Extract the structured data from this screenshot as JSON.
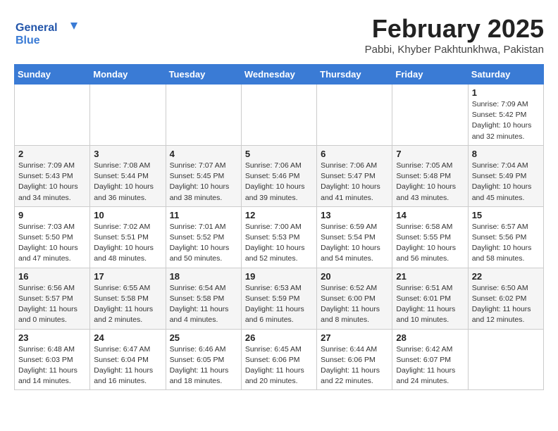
{
  "header": {
    "title": "February 2025",
    "location": "Pabbi, Khyber Pakhtunkhwa, Pakistan",
    "logo_general": "General",
    "logo_blue": "Blue"
  },
  "weekdays": [
    "Sunday",
    "Monday",
    "Tuesday",
    "Wednesday",
    "Thursday",
    "Friday",
    "Saturday"
  ],
  "weeks": [
    [
      {
        "day": "",
        "info": ""
      },
      {
        "day": "",
        "info": ""
      },
      {
        "day": "",
        "info": ""
      },
      {
        "day": "",
        "info": ""
      },
      {
        "day": "",
        "info": ""
      },
      {
        "day": "",
        "info": ""
      },
      {
        "day": "1",
        "info": "Sunrise: 7:09 AM\nSunset: 5:42 PM\nDaylight: 10 hours\nand 32 minutes."
      }
    ],
    [
      {
        "day": "2",
        "info": "Sunrise: 7:09 AM\nSunset: 5:43 PM\nDaylight: 10 hours\nand 34 minutes."
      },
      {
        "day": "3",
        "info": "Sunrise: 7:08 AM\nSunset: 5:44 PM\nDaylight: 10 hours\nand 36 minutes."
      },
      {
        "day": "4",
        "info": "Sunrise: 7:07 AM\nSunset: 5:45 PM\nDaylight: 10 hours\nand 38 minutes."
      },
      {
        "day": "5",
        "info": "Sunrise: 7:06 AM\nSunset: 5:46 PM\nDaylight: 10 hours\nand 39 minutes."
      },
      {
        "day": "6",
        "info": "Sunrise: 7:06 AM\nSunset: 5:47 PM\nDaylight: 10 hours\nand 41 minutes."
      },
      {
        "day": "7",
        "info": "Sunrise: 7:05 AM\nSunset: 5:48 PM\nDaylight: 10 hours\nand 43 minutes."
      },
      {
        "day": "8",
        "info": "Sunrise: 7:04 AM\nSunset: 5:49 PM\nDaylight: 10 hours\nand 45 minutes."
      }
    ],
    [
      {
        "day": "9",
        "info": "Sunrise: 7:03 AM\nSunset: 5:50 PM\nDaylight: 10 hours\nand 47 minutes."
      },
      {
        "day": "10",
        "info": "Sunrise: 7:02 AM\nSunset: 5:51 PM\nDaylight: 10 hours\nand 48 minutes."
      },
      {
        "day": "11",
        "info": "Sunrise: 7:01 AM\nSunset: 5:52 PM\nDaylight: 10 hours\nand 50 minutes."
      },
      {
        "day": "12",
        "info": "Sunrise: 7:00 AM\nSunset: 5:53 PM\nDaylight: 10 hours\nand 52 minutes."
      },
      {
        "day": "13",
        "info": "Sunrise: 6:59 AM\nSunset: 5:54 PM\nDaylight: 10 hours\nand 54 minutes."
      },
      {
        "day": "14",
        "info": "Sunrise: 6:58 AM\nSunset: 5:55 PM\nDaylight: 10 hours\nand 56 minutes."
      },
      {
        "day": "15",
        "info": "Sunrise: 6:57 AM\nSunset: 5:56 PM\nDaylight: 10 hours\nand 58 minutes."
      }
    ],
    [
      {
        "day": "16",
        "info": "Sunrise: 6:56 AM\nSunset: 5:57 PM\nDaylight: 11 hours\nand 0 minutes."
      },
      {
        "day": "17",
        "info": "Sunrise: 6:55 AM\nSunset: 5:58 PM\nDaylight: 11 hours\nand 2 minutes."
      },
      {
        "day": "18",
        "info": "Sunrise: 6:54 AM\nSunset: 5:58 PM\nDaylight: 11 hours\nand 4 minutes."
      },
      {
        "day": "19",
        "info": "Sunrise: 6:53 AM\nSunset: 5:59 PM\nDaylight: 11 hours\nand 6 minutes."
      },
      {
        "day": "20",
        "info": "Sunrise: 6:52 AM\nSunset: 6:00 PM\nDaylight: 11 hours\nand 8 minutes."
      },
      {
        "day": "21",
        "info": "Sunrise: 6:51 AM\nSunset: 6:01 PM\nDaylight: 11 hours\nand 10 minutes."
      },
      {
        "day": "22",
        "info": "Sunrise: 6:50 AM\nSunset: 6:02 PM\nDaylight: 11 hours\nand 12 minutes."
      }
    ],
    [
      {
        "day": "23",
        "info": "Sunrise: 6:48 AM\nSunset: 6:03 PM\nDaylight: 11 hours\nand 14 minutes."
      },
      {
        "day": "24",
        "info": "Sunrise: 6:47 AM\nSunset: 6:04 PM\nDaylight: 11 hours\nand 16 minutes."
      },
      {
        "day": "25",
        "info": "Sunrise: 6:46 AM\nSunset: 6:05 PM\nDaylight: 11 hours\nand 18 minutes."
      },
      {
        "day": "26",
        "info": "Sunrise: 6:45 AM\nSunset: 6:06 PM\nDaylight: 11 hours\nand 20 minutes."
      },
      {
        "day": "27",
        "info": "Sunrise: 6:44 AM\nSunset: 6:06 PM\nDaylight: 11 hours\nand 22 minutes."
      },
      {
        "day": "28",
        "info": "Sunrise: 6:42 AM\nSunset: 6:07 PM\nDaylight: 11 hours\nand 24 minutes."
      },
      {
        "day": "",
        "info": ""
      }
    ]
  ]
}
